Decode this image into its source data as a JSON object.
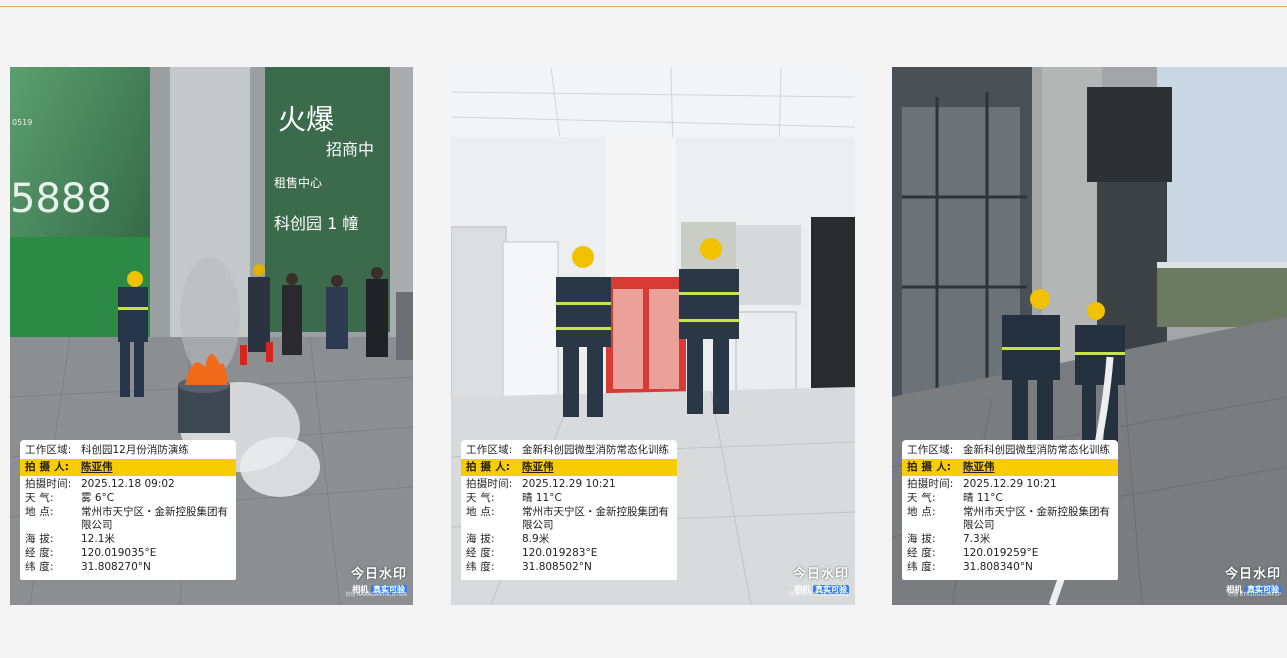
{
  "photos": [
    {
      "work_area_label": "工作区域:",
      "work_area": "科创园12月份消防演练",
      "photographer_label": "拍 摄 人:",
      "photographer": "陈亚伟",
      "time_label": "拍摄时间:",
      "time": "2025.12.18 09:02",
      "weather_label": "天 气:",
      "weather": "雾 6°C",
      "location_label": "地 点:",
      "location": "常州市天宁区・金新控股集团有限公司",
      "altitude_label": "海 拔:",
      "altitude": "12.1米",
      "longitude_label": "经 度:",
      "longitude": "120.019035°E",
      "latitude_label": "纬 度:",
      "latitude": "31.808270°N",
      "brand_line1": "今日水印",
      "brand_line2a": "相机",
      "brand_line2b": "真实可验",
      "brand_code": "防伪 RAAAGANYRCDTWR"
    },
    {
      "work_area_label": "工作区域:",
      "work_area": "金新科创园微型消防常态化训练",
      "photographer_label": "拍 摄 人:",
      "photographer": "陈亚伟",
      "time_label": "拍摄时间:",
      "time": "2025.12.29 10:21",
      "weather_label": "天 气:",
      "weather": "晴 11°C",
      "location_label": "地 点:",
      "location": "常州市天宁区・金新控股集团有限公司",
      "altitude_label": "海 拔:",
      "altitude": "8.9米",
      "longitude_label": "经 度:",
      "longitude": "120.019283°E",
      "latitude_label": "纬 度:",
      "latitude": "31.808502°N",
      "brand_line1": "今日水印",
      "brand_line2a": "相机",
      "brand_line2b": "真实可验",
      "brand_code": "防伪 MYIXNCSE7SLEAE1"
    },
    {
      "work_area_label": "工作区域:",
      "work_area": "金新科创园微型消防常态化训练",
      "photographer_label": "拍 摄 人:",
      "photographer": "陈亚伟",
      "time_label": "拍摄时间:",
      "time": "2025.12.29 10:21",
      "weather_label": "天 气:",
      "weather": "晴 11°C",
      "location_label": "地 点:",
      "location": "常州市天宁区・金新控股集团有限公司",
      "altitude_label": "海 拔:",
      "altitude": "7.3米",
      "longitude_label": "经 度:",
      "longitude": "120.019259°E",
      "latitude_label": "纬 度:",
      "latitude": "31.808340°N",
      "brand_line1": "今日水印",
      "brand_line2a": "相机",
      "brand_line2b": "真实可验",
      "brand_code": "防伪 BT63DD1DMPXP"
    }
  ],
  "scene_text": {
    "photo1_sign_a": "火爆",
    "photo1_sign_b": "招商中",
    "photo1_sign_c": "租售中心",
    "photo1_sign_d": "科创园 1 幢",
    "photo1_big_number": "5888",
    "photo1_badge": "0519"
  },
  "colors": {
    "accent_line": "#f2a34a",
    "highlight": "#f7cc00",
    "brand_chip": "#2f7cf6"
  }
}
